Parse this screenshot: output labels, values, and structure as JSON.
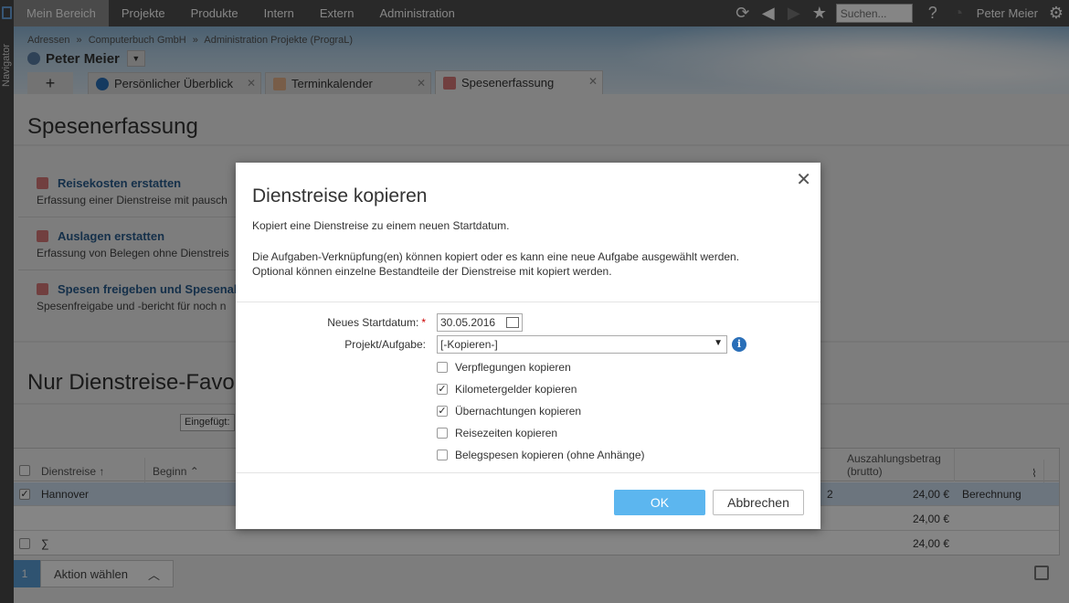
{
  "navigator": {
    "label": "Navigator"
  },
  "topbar": {
    "menu": [
      "Mein Bereich",
      "Projekte",
      "Produkte",
      "Intern",
      "Extern",
      "Administration"
    ],
    "search_placeholder": "Suchen...",
    "help": "?",
    "user": "Peter Meier"
  },
  "breadcrumb": [
    "Adressen",
    "»",
    "Computerbuch GmbH",
    "»",
    "Administration Projekte (PrograL)"
  ],
  "person": {
    "name": "Peter Meier"
  },
  "tabs": {
    "add": "+",
    "items": [
      "Persönlicher Überblick",
      "Terminkalender",
      "Spesenerfassung"
    ]
  },
  "page": {
    "title": "Spesenerfassung",
    "links": [
      {
        "title": "Reisekosten erstatten",
        "desc": "Erfassung einer Dienstreise mit pausch"
      },
      {
        "title": "Auslagen erstatten",
        "desc": "Erfassung von Belegen ohne Dienstreis"
      },
      {
        "title": "Spesen freigeben und Spesenabs",
        "desc": "Spesenfreigabe und -bericht für noch n"
      }
    ],
    "section_title": "Nur Dienstreise-Favo",
    "filter_label": "Eingefügt:"
  },
  "table": {
    "headers": {
      "dienstreise": "Dienstreise",
      "beginn": "Beginn",
      "auszahlung": "Auszahlungsbetrag",
      "auszahlung_sub": "(brutto)"
    },
    "rows": [
      {
        "name": "Hannover",
        "count": "2",
        "amount": "24,00 €",
        "type": "Berechnung"
      },
      {
        "name": "",
        "count": "",
        "amount": "24,00 €",
        "type": ""
      },
      {
        "name": "∑",
        "count": "",
        "amount": "24,00 €",
        "type": ""
      }
    ]
  },
  "action_bar": {
    "count": "1",
    "label": "Aktion wählen"
  },
  "modal": {
    "title": "Dienstreise kopieren",
    "text1": "Kopiert eine Dienstreise zu einem neuen Startdatum.",
    "text2": "Die Aufgaben-Verknüpfung(en) können kopiert oder es kann eine neue Aufgabe ausgewählt werden.",
    "text3": "Optional können einzelne Bestandteile der Dienstreise mit kopiert werden.",
    "start_label": "Neues Startdatum:",
    "required_mark": "*",
    "start_value": "30.05.2016",
    "project_label": "Projekt/Aufgabe:",
    "project_value": "[-Kopieren-]",
    "checkboxes": [
      {
        "label": "Verpflegungen kopieren",
        "checked": false
      },
      {
        "label": "Kilometergelder kopieren",
        "checked": true
      },
      {
        "label": "Übernachtungen kopieren",
        "checked": true
      },
      {
        "label": "Reisezeiten kopieren",
        "checked": false
      },
      {
        "label": "Belegspesen kopieren (ohne Anhänge)",
        "checked": false
      }
    ],
    "ok": "OK",
    "cancel": "Abbrechen"
  }
}
